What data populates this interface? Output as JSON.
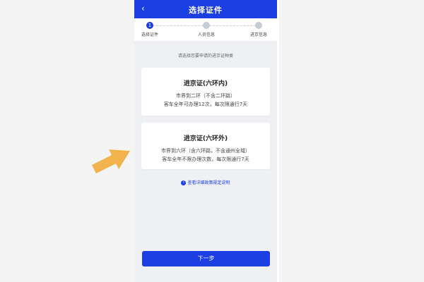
{
  "header": {
    "back_icon": "‹",
    "title": "选择证件"
  },
  "steps": [
    {
      "number": "1",
      "label": "选择证件",
      "active": true
    },
    {
      "label": "人员信息",
      "active": false
    },
    {
      "label": "进京信息",
      "active": false
    }
  ],
  "hint": "请选择您要申请的进京证种类",
  "cards": [
    {
      "title": "进京证(六环内)",
      "line1": "市界到二环（不含二环路）",
      "line2": "客车全年可办理12次，每次限通行7天"
    },
    {
      "title": "进京证(六环外)",
      "line1": "市界到六环（含六环路，不含通州全域）",
      "line2": "客车全年不限办理次数，每次限通行7天"
    }
  ],
  "policy_link": "查看详细政策规定说明",
  "next_button": "下一步",
  "colors": {
    "accent": "#1b3fe2",
    "arrow": "#f2b24c",
    "page_background": "#eef0f4"
  },
  "icons": {
    "back": "chevron-left-icon",
    "policy": "info-icon",
    "pointer": "arrow-right-icon"
  }
}
